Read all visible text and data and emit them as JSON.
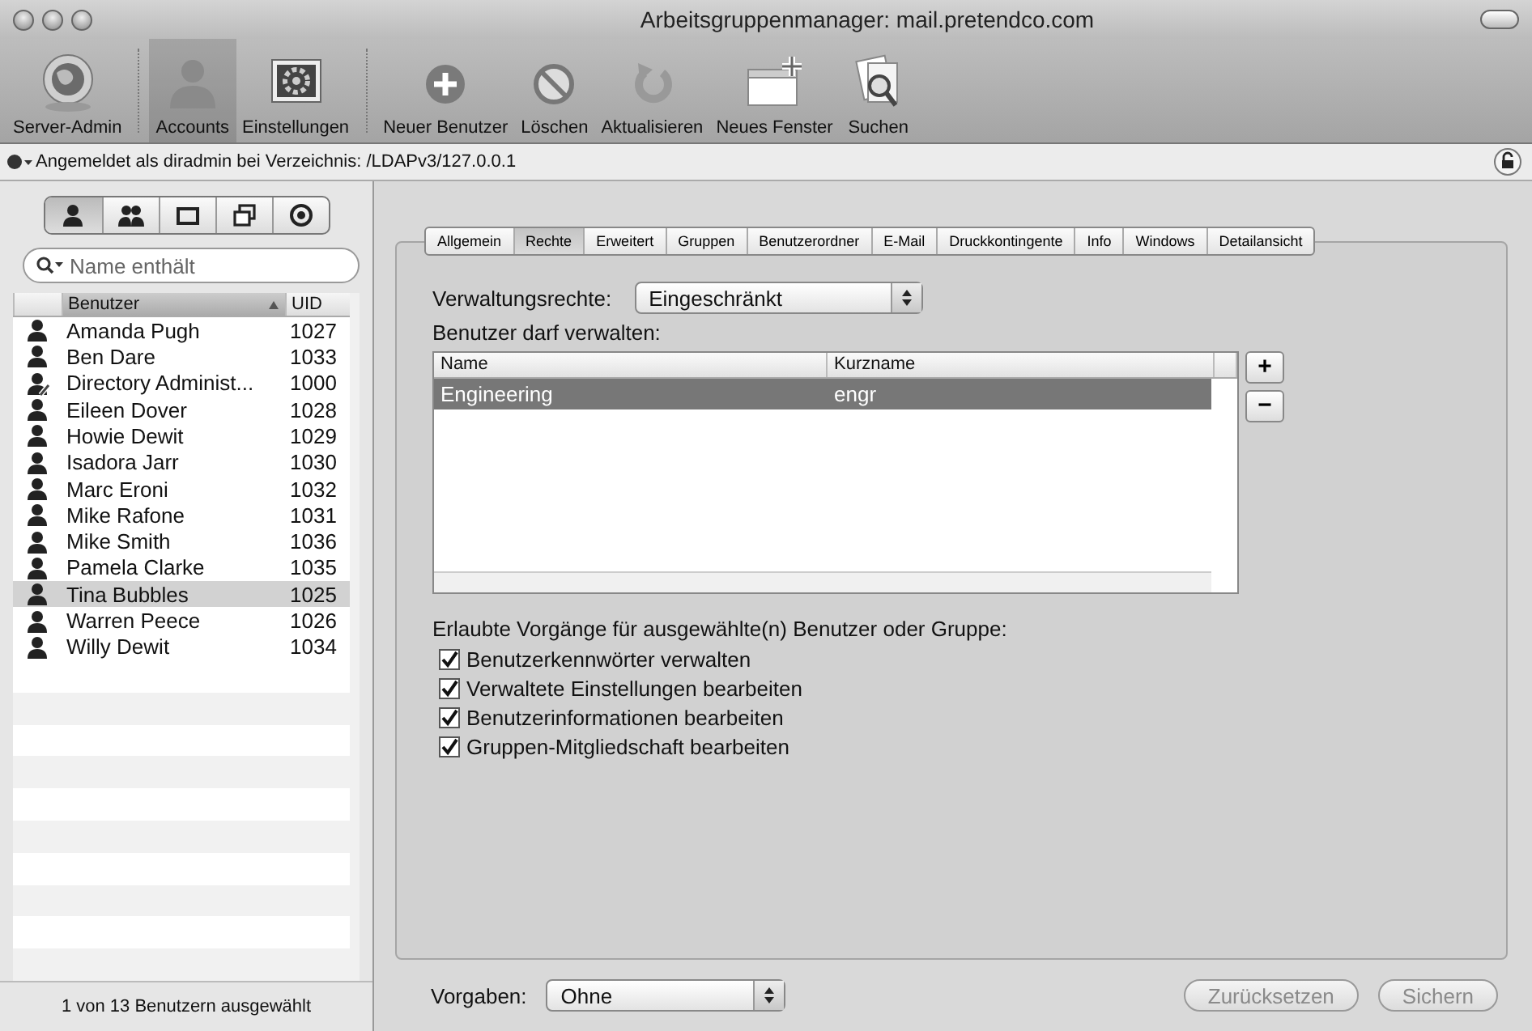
{
  "window": {
    "title": "Arbeitsgruppenmanager: mail.pretendco.com"
  },
  "toolbar": [
    {
      "label": "Server-Admin",
      "kind": "server",
      "selected": false
    },
    {
      "label": "Accounts",
      "kind": "accounts",
      "selected": true
    },
    {
      "label": "Einstellungen",
      "kind": "settings",
      "selected": false
    },
    {
      "label": "Neuer Benutzer",
      "kind": "add",
      "selected": false
    },
    {
      "label": "Löschen",
      "kind": "delete",
      "selected": false
    },
    {
      "label": "Aktualisieren",
      "kind": "refresh",
      "selected": false
    },
    {
      "label": "Neues Fenster",
      "kind": "window",
      "selected": false
    },
    {
      "label": "Suchen",
      "kind": "search",
      "selected": false
    }
  ],
  "status": {
    "text": "Angemeldet als diradmin bei Verzeichnis: /LDAPv3/127.0.0.1"
  },
  "sidebar": {
    "filters": [
      {
        "kind": "users",
        "selected": true
      },
      {
        "kind": "groups",
        "selected": false
      },
      {
        "kind": "computer",
        "selected": false
      },
      {
        "kind": "computer-groups",
        "selected": false
      },
      {
        "kind": "lists",
        "selected": false
      }
    ],
    "search": {
      "placeholder": "Name enthält"
    },
    "columns": [
      "Benutzer",
      "UID"
    ],
    "users": [
      {
        "name": "Amanda Pugh",
        "uid": "1027",
        "kind": "user",
        "selected": false
      },
      {
        "name": "Ben Dare",
        "uid": "1033",
        "kind": "user",
        "selected": false
      },
      {
        "name": "Directory Administ...",
        "uid": "1000",
        "kind": "admin",
        "selected": false
      },
      {
        "name": "Eileen Dover",
        "uid": "1028",
        "kind": "user",
        "selected": false
      },
      {
        "name": "Howie Dewit",
        "uid": "1029",
        "kind": "user",
        "selected": false
      },
      {
        "name": "Isadora Jarr",
        "uid": "1030",
        "kind": "user",
        "selected": false
      },
      {
        "name": "Marc Eroni",
        "uid": "1032",
        "kind": "user",
        "selected": false
      },
      {
        "name": "Mike Rafone",
        "uid": "1031",
        "kind": "user",
        "selected": false
      },
      {
        "name": "Mike Smith",
        "uid": "1036",
        "kind": "user",
        "selected": false
      },
      {
        "name": "Pamela Clarke",
        "uid": "1035",
        "kind": "user",
        "selected": false
      },
      {
        "name": "Tina Bubbles",
        "uid": "1025",
        "kind": "user",
        "selected": true
      },
      {
        "name": "Warren Peece",
        "uid": "1026",
        "kind": "user",
        "selected": false
      },
      {
        "name": "Willy Dewit",
        "uid": "1034",
        "kind": "user",
        "selected": false
      }
    ],
    "footer": "1 von 13 Benutzern ausgewählt"
  },
  "tabs": [
    {
      "label": "Allgemein",
      "selected": false
    },
    {
      "label": "Rechte",
      "selected": true
    },
    {
      "label": "Erweitert",
      "selected": false
    },
    {
      "label": "Gruppen",
      "selected": false
    },
    {
      "label": "Benutzerordner",
      "selected": false
    },
    {
      "label": "E-Mail",
      "selected": false
    },
    {
      "label": "Druckkontingente",
      "selected": false
    },
    {
      "label": "Info",
      "selected": false
    },
    {
      "label": "Windows",
      "selected": false
    },
    {
      "label": "Detailansicht",
      "selected": false
    }
  ],
  "rights": {
    "label": "Verwaltungsrechte:",
    "value": "Eingeschränkt",
    "manage_label": "Benutzer darf verwalten:",
    "table": {
      "columns": [
        "Name",
        "Kurzname"
      ],
      "rows": [
        {
          "name": "Engineering",
          "short": "engr",
          "selected": true
        }
      ]
    },
    "add": "+",
    "remove": "−",
    "options_label": "Erlaubte Vorgänge für ausgewählte(n) Benutzer oder Gruppe:",
    "options": [
      {
        "label": "Benutzerkennwörter verwalten",
        "checked": true
      },
      {
        "label": "Verwaltete Einstellungen bearbeiten",
        "checked": true
      },
      {
        "label": "Benutzerinformationen bearbeiten",
        "checked": true
      },
      {
        "label": "Gruppen-Mitgliedschaft bearbeiten",
        "checked": true
      }
    ]
  },
  "footer": {
    "label": "Vorgaben:",
    "value": "Ohne",
    "buttons": [
      {
        "label": "Zurücksetzen",
        "disabled": true
      },
      {
        "label": "Sichern",
        "disabled": true
      }
    ]
  }
}
